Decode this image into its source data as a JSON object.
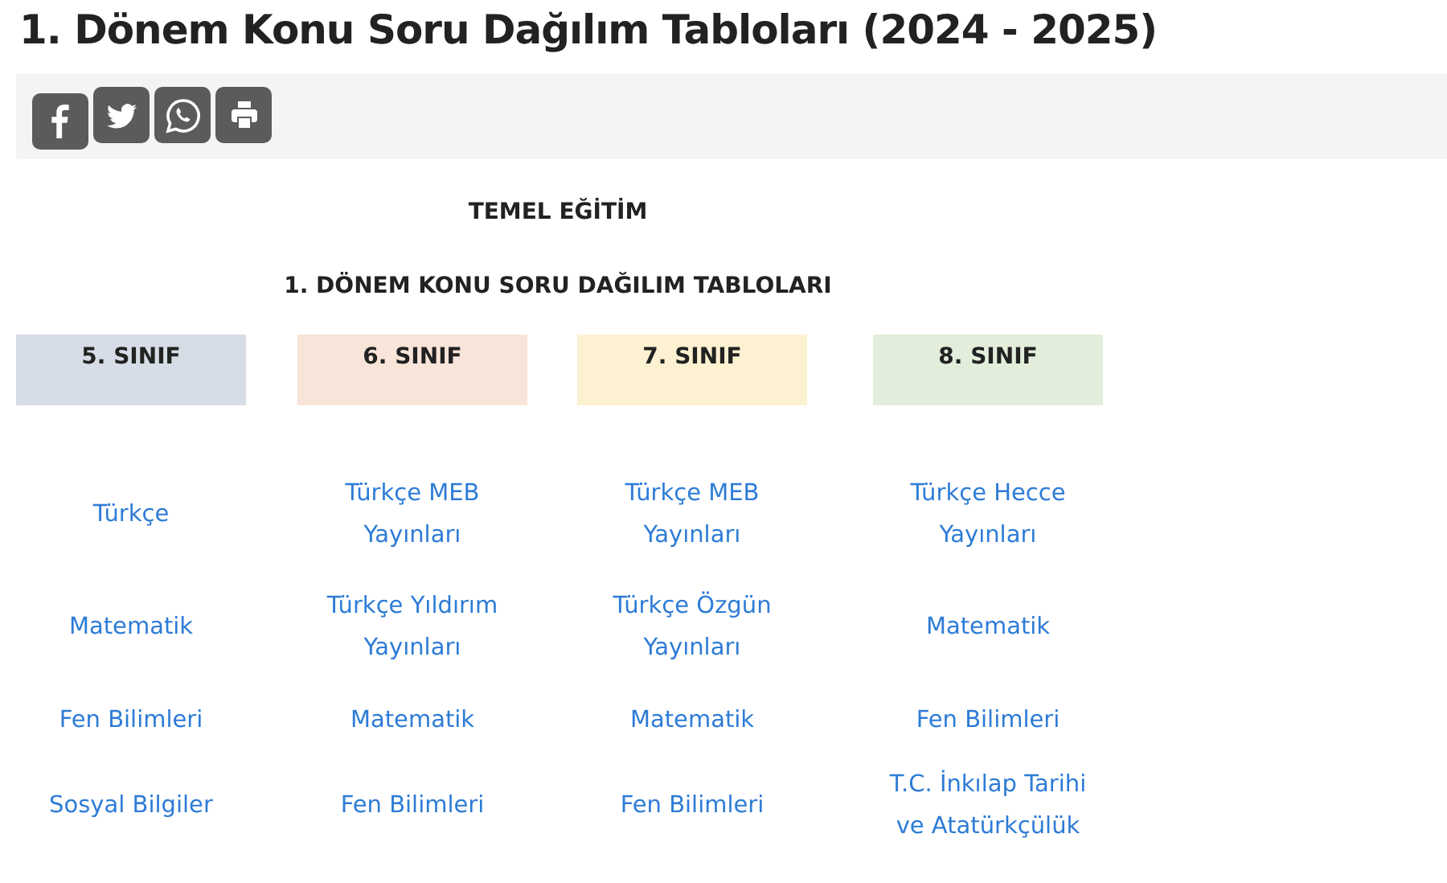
{
  "title": "1. Dönem Konu Soru Dağılım Tabloları (2024 - 2025)",
  "share_buttons": [
    {
      "kind": "facebook"
    },
    {
      "kind": "twitter"
    },
    {
      "kind": "whatsapp"
    },
    {
      "kind": "print"
    }
  ],
  "section_heading": "TEMEL EĞİTİM",
  "table_heading": "1. DÖNEM KONU SORU DAĞILIM TABLOLARI",
  "grades": [
    {
      "header": "5. SINIF",
      "color": "#d6dde6",
      "links": [
        "Türkçe",
        "Matematik",
        "Fen Bilimleri",
        "Sosyal Bilgiler"
      ]
    },
    {
      "header": "6. SINIF",
      "color": "#f8e4d8",
      "links": [
        "Türkçe MEB Yayınları",
        "Türkçe Yıldırım Yayınları",
        "Matematik",
        "Fen Bilimleri"
      ]
    },
    {
      "header": "7. SINIF",
      "color": "#fcf1d0",
      "links": [
        "Türkçe MEB Yayınları",
        "Türkçe Özgün Yayınları",
        "Matematik",
        "Fen Bilimleri"
      ]
    },
    {
      "header": "8. SINIF",
      "color": "#e2eedb",
      "links": [
        "Türkçe Hecce Yayınları",
        "Matematik",
        "Fen Bilimleri",
        "T.C. İnkılap Tarihi ve Atatürkçülük"
      ]
    }
  ]
}
